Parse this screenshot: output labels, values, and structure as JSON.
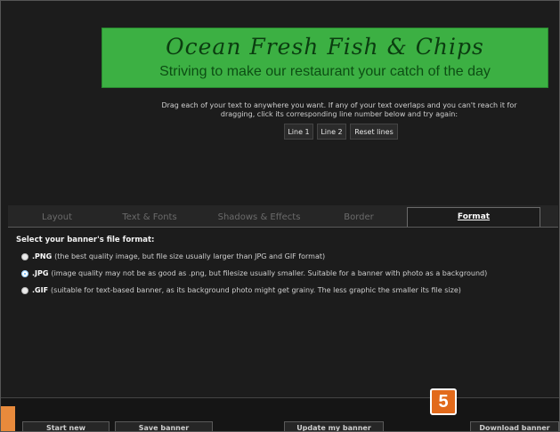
{
  "banner": {
    "title": "Ocean Fresh Fish & Chips",
    "subtitle": "Striving to make our restaurant your catch of the day"
  },
  "instructions": "Drag each of your text to anywhere you want. If any of your text overlaps and you can't reach it for dragging, click its corresponding line number below and try again:",
  "line_buttons": [
    "Line 1",
    "Line 2",
    "Reset lines"
  ],
  "tabs": [
    {
      "label": "Layout",
      "active": false
    },
    {
      "label": "Text & Fonts",
      "active": false
    },
    {
      "label": "Shadows & Effects",
      "active": false
    },
    {
      "label": "Border",
      "active": false
    },
    {
      "label": "Format",
      "active": true
    }
  ],
  "format": {
    "title": "Select your banner's file format:",
    "options": [
      {
        "label": ".PNG",
        "desc": "(the best quality image, but file size usually larger than JPG and GIF format)",
        "selected": false
      },
      {
        "label": ".JPG",
        "desc": "(image quality may not be as good as .png, but filesize usually smaller. Suitable for a banner with photo as a background)",
        "selected": true
      },
      {
        "label": ".GIF",
        "desc": "(suitable for text-based banner, as its background photo might get grainy. The less graphic the smaller its file size)",
        "selected": false
      }
    ]
  },
  "bottom_buttons": {
    "start_new": "Start new",
    "save_banner": "Save banner",
    "update_banner": "Update my banner",
    "download_banner": "Download banner"
  },
  "step_badge": "5",
  "colors": {
    "banner_bg": "#3cb043",
    "accent": "#e26a1b",
    "selected_radio": "#5ab4ff"
  }
}
